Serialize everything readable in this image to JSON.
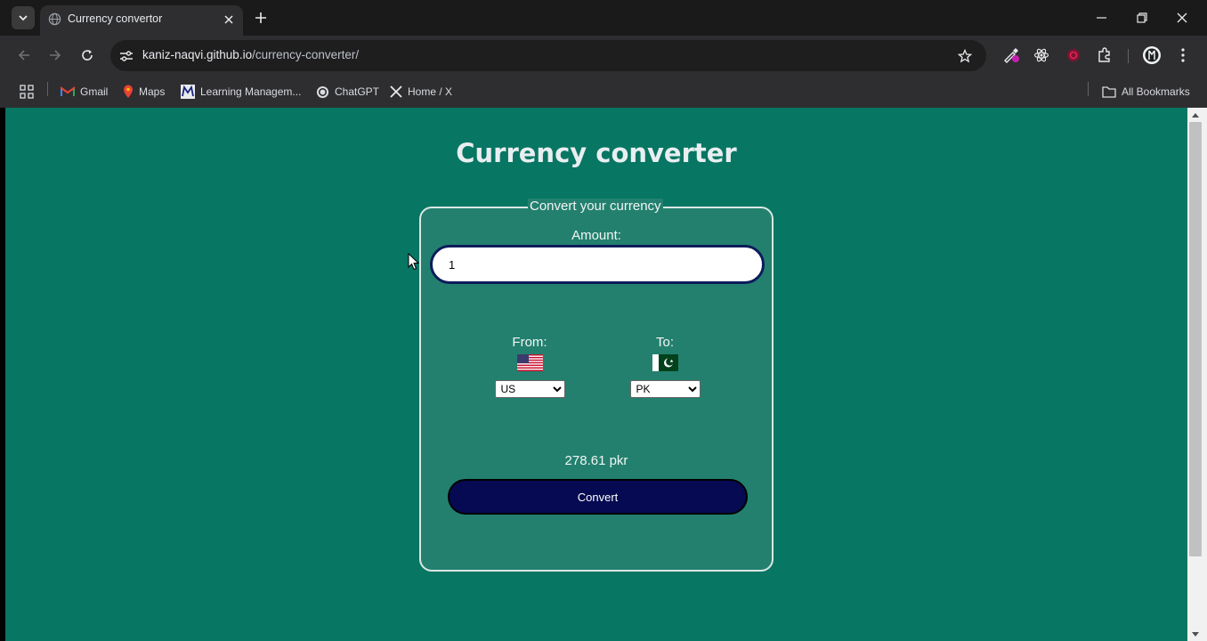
{
  "browser": {
    "tab": {
      "title": "Currency convertor"
    },
    "address_bar": {
      "host": "kaniz-naqvi.github.io",
      "path": "/currency-converter/"
    },
    "bookmarks": [
      {
        "label": "Gmail",
        "icon": "gmail-icon"
      },
      {
        "label": "Maps",
        "icon": "maps-icon"
      },
      {
        "label": "Learning Managem...",
        "icon": "lms-icon"
      },
      {
        "label": "ChatGPT",
        "icon": "chatgpt-icon"
      },
      {
        "label": "Home / X",
        "icon": "x-icon"
      }
    ],
    "all_bookmarks_label": "All Bookmarks",
    "icons": [
      "tab-search-icon",
      "globe-icon",
      "close-icon",
      "plus-icon",
      "minimize-icon",
      "restore-icon",
      "back-icon",
      "forward-icon",
      "reload-icon",
      "site-info-icon",
      "star-icon",
      "eyedropper-icon",
      "react-icon",
      "extension-red-icon",
      "puzzle-icon",
      "profile-icon",
      "menu-icon",
      "apps-icon",
      "folder-icon"
    ]
  },
  "page": {
    "title": "Currency converter",
    "form": {
      "legend": "Convert your currency",
      "amount_label": "Amount:",
      "amount_value": "1",
      "from": {
        "label": "From:",
        "selected": "US",
        "flag": "us-flag"
      },
      "to": {
        "label": "To:",
        "selected": "PK",
        "flag": "pk-flag"
      },
      "result": "278.61 pkr",
      "convert_label": "Convert"
    }
  },
  "colors": {
    "page_background": "#077663",
    "card_background": "#23806f",
    "input_border": "#0c1c5a",
    "button_background": "#050a52"
  }
}
